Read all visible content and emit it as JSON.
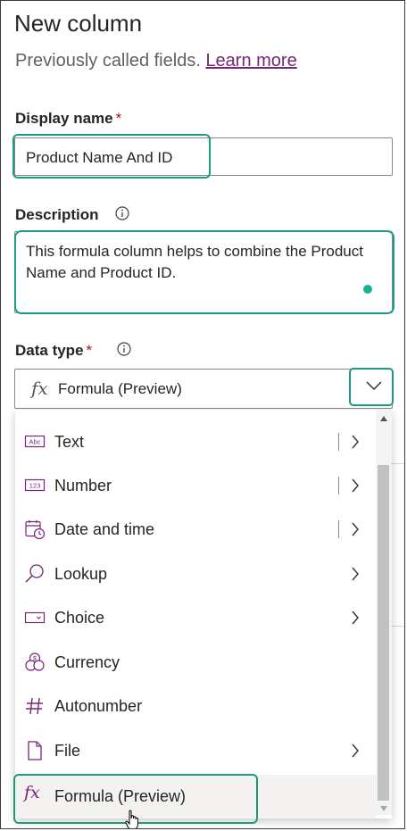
{
  "panel": {
    "title": "New column",
    "subtitle": "Previously called fields.",
    "learn_more": "Learn more"
  },
  "display_name": {
    "label": "Display name",
    "required_mark": "*",
    "value": "Product Name And ID"
  },
  "description": {
    "label": "Description",
    "value": "This formula column helps to combine the Product Name and Product ID."
  },
  "data_type": {
    "label": "Data type",
    "required_mark": "*",
    "selected_icon": "fx",
    "selected_value": "Formula (Preview)"
  },
  "menu": {
    "items": [
      {
        "label": "Text",
        "icon": "text-abc-icon",
        "submenu": true,
        "separator": true
      },
      {
        "label": "Number",
        "icon": "number-123-icon",
        "submenu": true,
        "separator": true
      },
      {
        "label": "Date and time",
        "icon": "calendar-clock-icon",
        "submenu": true,
        "separator": true
      },
      {
        "label": "Lookup",
        "icon": "lookup-search-icon",
        "submenu": true,
        "separator": false
      },
      {
        "label": "Choice",
        "icon": "choice-dropdown-icon",
        "submenu": true,
        "separator": false
      },
      {
        "label": "Currency",
        "icon": "currency-coins-icon",
        "submenu": false,
        "separator": false
      },
      {
        "label": "Autonumber",
        "icon": "hash-icon",
        "submenu": false,
        "separator": false
      },
      {
        "label": "File",
        "icon": "file-icon",
        "submenu": true,
        "separator": false
      },
      {
        "label": "Formula (Preview)",
        "icon": "fx",
        "submenu": false,
        "separator": false,
        "selected": true
      }
    ]
  },
  "colors": {
    "highlight": "#1f9a80",
    "link": "#742774",
    "icon": "#742774",
    "required": "#b10e1c"
  }
}
